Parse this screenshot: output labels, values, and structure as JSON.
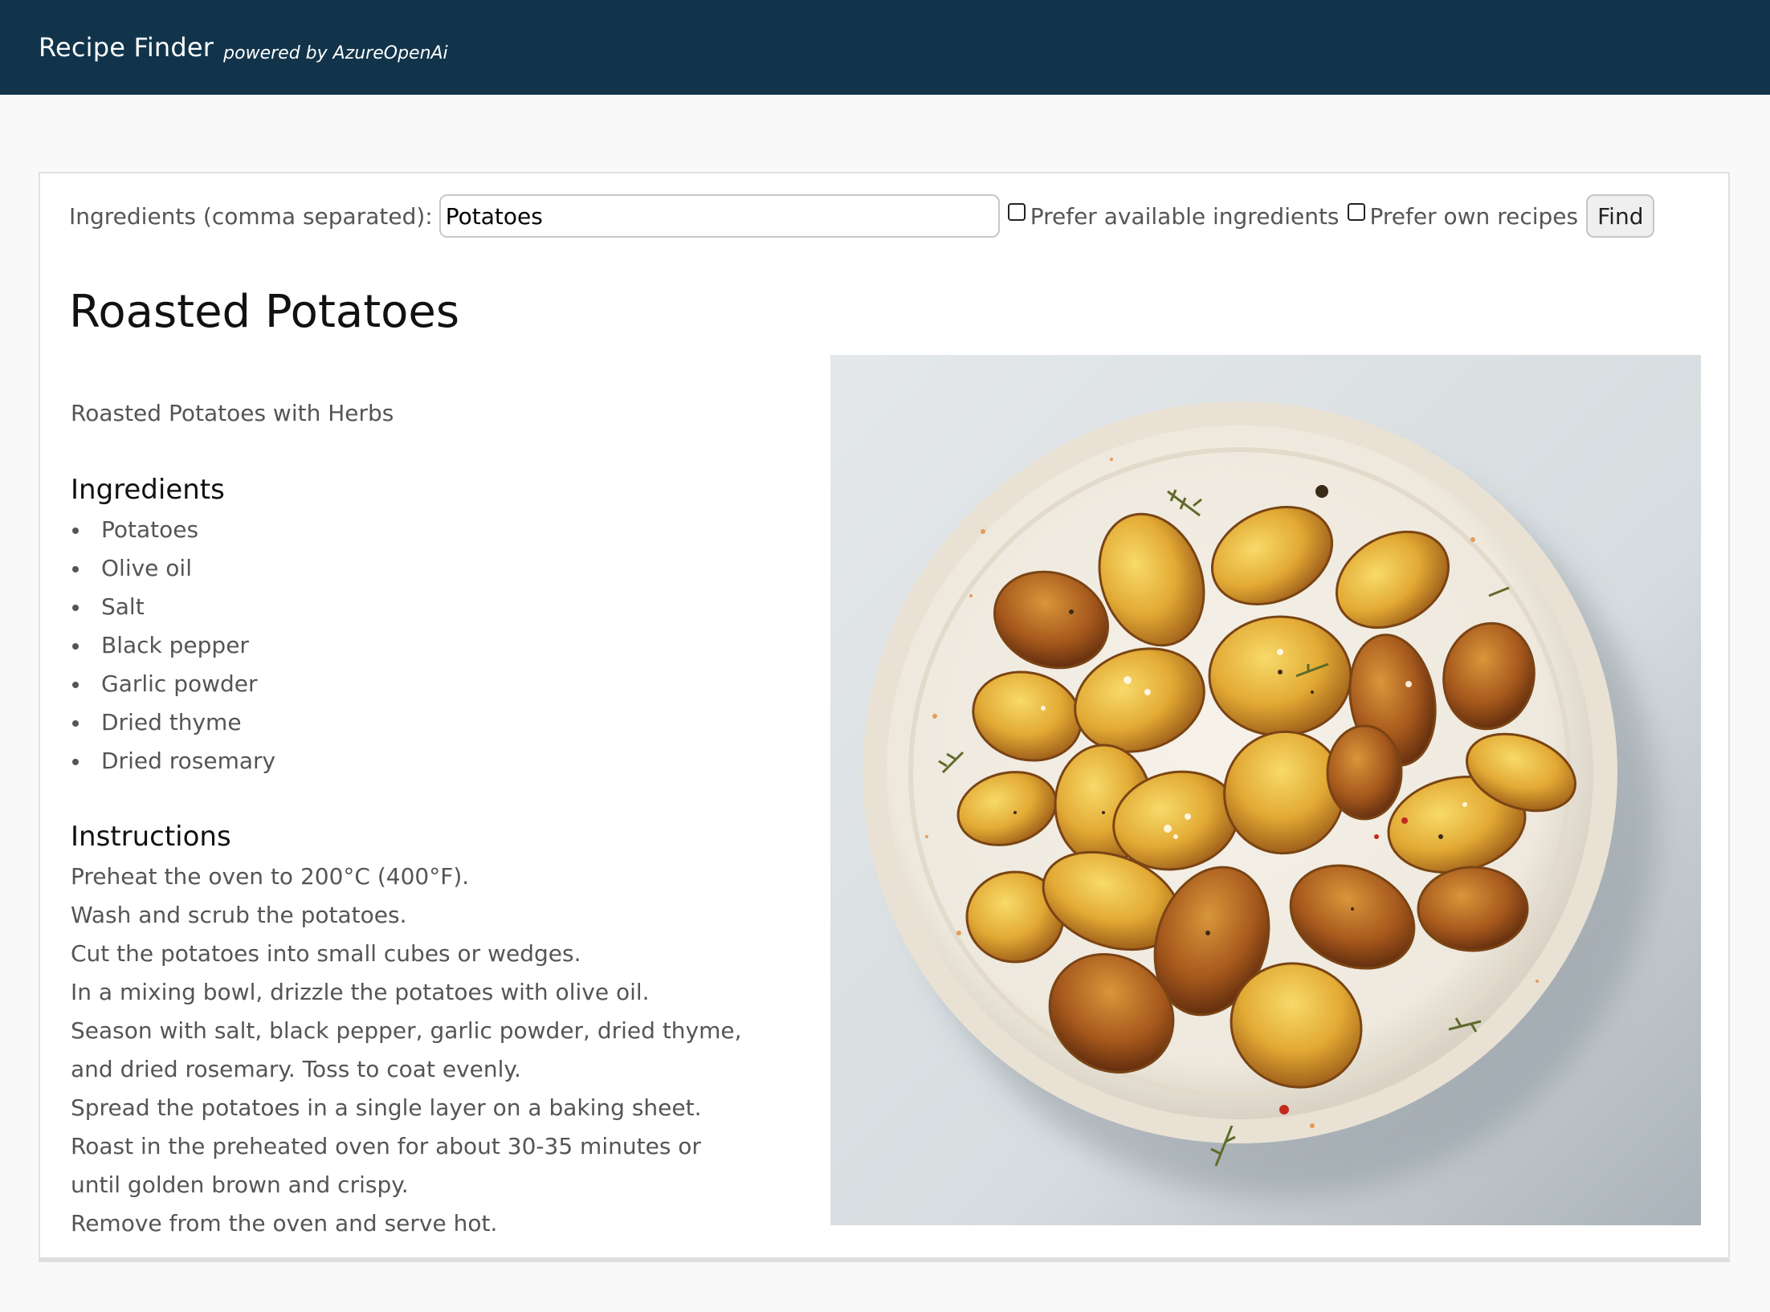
{
  "header": {
    "app_title": "Recipe Finder",
    "powered_by": "powered by AzureOpenAi",
    "background_color": "#12344b"
  },
  "search": {
    "label": "Ingredients (comma separated):",
    "value": "Potatoes",
    "prefer_available_label": "Prefer available ingredients",
    "prefer_available_checked": false,
    "prefer_own_label": "Prefer own recipes",
    "prefer_own_checked": false,
    "find_label": "Find"
  },
  "recipe": {
    "title": "Roasted Potatoes",
    "subtitle": "Roasted Potatoes with Herbs",
    "ingredients_heading": "Ingredients",
    "ingredients": [
      "Potatoes",
      "Olive oil",
      "Salt",
      "Black pepper",
      "Garlic powder",
      "Dried thyme",
      "Dried rosemary"
    ],
    "instructions_heading": "Instructions",
    "instructions": [
      "Preheat the oven to 200°C (400°F).",
      "Wash and scrub the potatoes.",
      "Cut the potatoes into small cubes or wedges.",
      "In a mixing bowl, drizzle the potatoes with olive oil.",
      "Season with salt, black pepper, garlic powder, dried thyme, and dried rosemary. Toss to coat evenly.",
      "Spread the potatoes in a single layer on a baking sheet.",
      "Roast in the preheated oven for about 30-35 minutes or until golden brown and crispy.",
      "Remove from the oven and serve hot."
    ]
  }
}
